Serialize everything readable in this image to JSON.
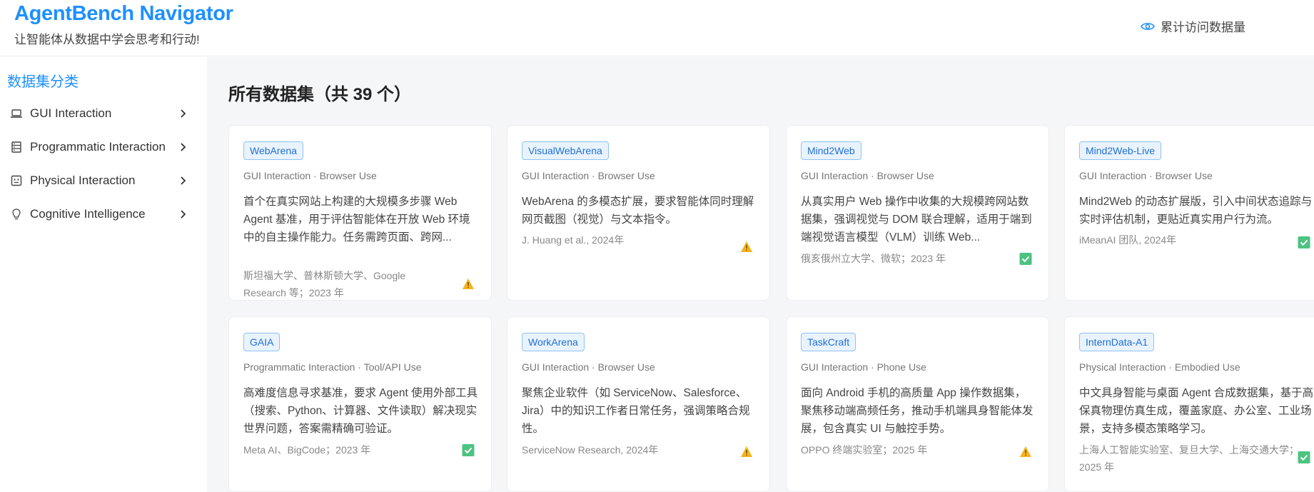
{
  "header": {
    "title": "AgentBench Navigator",
    "subtitle": "让智能体从数据中学会思考和行动!",
    "visits_label": "累计访问数据量"
  },
  "sidebar": {
    "title": "数据集分类",
    "items": [
      {
        "label": "GUI Interaction",
        "icon": "laptop-icon"
      },
      {
        "label": "Programmatic Interaction",
        "icon": "server-icon"
      },
      {
        "label": "Physical Interaction",
        "icon": "robot-icon"
      },
      {
        "label": "Cognitive Intelligence",
        "icon": "lightbulb-icon"
      }
    ]
  },
  "main": {
    "title": "所有数据集（共 39 个）",
    "cards": [
      {
        "name": "WebArena",
        "category": "GUI Interaction · Browser Use",
        "desc": "首个在真实网站上构建的大规模多步骤 Web Agent 基准，用于评估智能体在开放 Web 环境中的自主操作能力。任务需跨页面、跨网...",
        "meta": "斯坦福大学、普林斯顿大学、Google Research 等；2023 年",
        "status": "warning"
      },
      {
        "name": "VisualWebArena",
        "category": "GUI Interaction · Browser Use",
        "desc": "WebArena 的多模态扩展，要求智能体同时理解网页截图（视觉）与文本指令。",
        "meta": "J. Huang et al., 2024年",
        "status": "warning"
      },
      {
        "name": "Mind2Web",
        "category": "GUI Interaction · Browser Use",
        "desc": "从真实用户 Web 操作中收集的大规模跨网站数据集，强调视觉与 DOM 联合理解，适用于端到端视觉语言模型（VLM）训练 Web...",
        "meta": "俄亥俄州立大学、微软；2023 年",
        "status": "ok"
      },
      {
        "name": "Mind2Web-Live",
        "category": "GUI Interaction · Browser Use",
        "desc": "Mind2Web 的动态扩展版，引入中间状态追踪与实时评估机制，更贴近真实用户行为流。",
        "meta": "iMeanAI 团队, 2024年",
        "status": "ok"
      },
      {
        "name": "GAIA",
        "category": "Programmatic Interaction · Tool/API Use",
        "desc": "高难度信息寻求基准，要求 Agent 使用外部工具（搜索、Python、计算器、文件读取）解决现实世界问题，答案需精确可验证。",
        "meta": "Meta AI、BigCode；2023 年",
        "status": "ok"
      },
      {
        "name": "WorkArena",
        "category": "GUI Interaction · Browser Use",
        "desc": "聚焦企业软件（如 ServiceNow、Salesforce、Jira）中的知识工作者日常任务，强调策略合规性。",
        "meta": "ServiceNow Research, 2024年",
        "status": "warning"
      },
      {
        "name": "TaskCraft",
        "category": "GUI Interaction · Phone Use",
        "desc": "面向 Android 手机的高质量 App 操作数据集，聚焦移动端高频任务，推动手机端具身智能体发展，包含真实 UI 与触控手势。",
        "meta": "OPPO 终端实验室；2025 年",
        "status": "warning"
      },
      {
        "name": "InternData-A1",
        "category": "Physical Interaction · Embodied Use",
        "desc": "中文具身智能与桌面 Agent 合成数据集，基于高保真物理仿真生成，覆盖家庭、办公室、工业场景，支持多模态策略学习。",
        "meta": "上海人工智能实验室、复旦大学、上海交通大学；2025 年",
        "status": "ok"
      }
    ]
  },
  "colors": {
    "accent": "#1e90ff",
    "warning": "#f2b31b",
    "ok": "#4cc380"
  }
}
